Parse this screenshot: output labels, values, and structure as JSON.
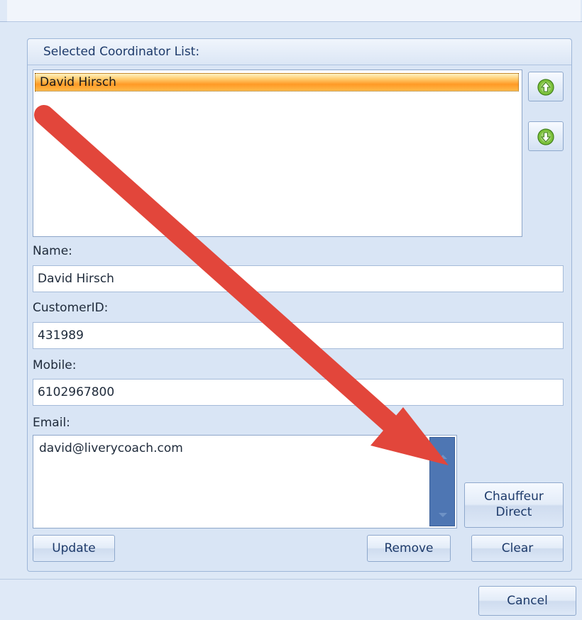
{
  "group": {
    "title": "Selected Coordinator List:"
  },
  "coordinators": {
    "items": [
      "David Hirsch"
    ]
  },
  "icons": {
    "move_up": "arrow-up-circle-icon",
    "move_down": "arrow-down-circle-icon"
  },
  "fields": {
    "name": {
      "label": "Name:",
      "value": "David Hirsch"
    },
    "customer_id": {
      "label": "CustomerID:",
      "value": "431989"
    },
    "mobile": {
      "label": "Mobile:",
      "value": "6102967800"
    },
    "email": {
      "label": "Email:",
      "value": "david@liverycoach.com"
    }
  },
  "buttons": {
    "update": "Update",
    "remove": "Remove",
    "clear": "Clear",
    "chauffeur_line1": "Chauffeur",
    "chauffeur_line2": "Direct",
    "cancel": "Cancel"
  },
  "colors": {
    "accent_arrow": "#e2463b",
    "selection": "#ff9a26",
    "scrollbar": "#4e76b3"
  }
}
